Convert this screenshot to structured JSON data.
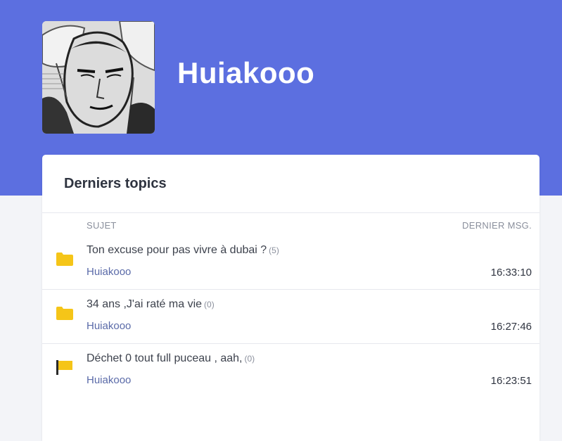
{
  "profile": {
    "username": "Huiakooo"
  },
  "card": {
    "title": "Derniers topics",
    "columns": {
      "subject": "SUJET",
      "last_message": "DERNIER MSG."
    }
  },
  "topics": [
    {
      "title": "Ton excuse pour pas vivre à dubai ?",
      "count": "(5)",
      "author": "Huiakooo",
      "time": "16:33:10",
      "icon": "folder-icon"
    },
    {
      "title": "34 ans ,J'ai raté ma vie",
      "count": "(0)",
      "author": "Huiakooo",
      "time": "16:27:46",
      "icon": "folder-icon"
    },
    {
      "title": "Déchet 0 tout full puceau , aah,",
      "count": "(0)",
      "author": "Huiakooo",
      "time": "16:23:51",
      "icon": "flag-icon"
    }
  ],
  "colors": {
    "banner": "#5c6fe0",
    "icon_yellow": "#f5c518",
    "author_link": "#5a6aa8"
  }
}
